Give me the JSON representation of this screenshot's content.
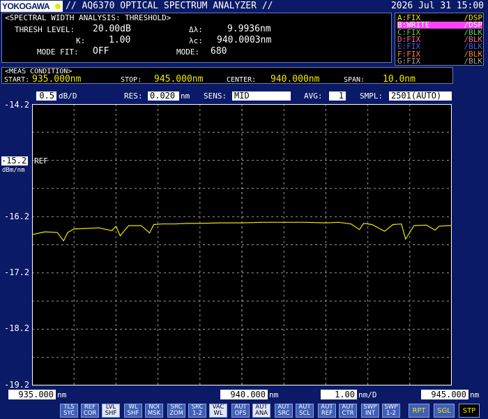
{
  "brand": "YOKOGAWA",
  "app_title": "// AQ6370 OPTICAL SPECTRUM ANALYZER //",
  "datetime": "2026 Jul 31 15:00",
  "analysis": {
    "header": "<SPECTRAL WIDTH ANALYSIS: THRESHOLD>",
    "thresh_label": "THRESH LEVEL:",
    "thresh_value": "20.00dB",
    "k_label": "K:",
    "k_value": "1.00",
    "modefit_label": "MODE FIT:",
    "modefit_value": "OFF",
    "dl_label": "Δλ:",
    "dl_value": "9.9936nm",
    "lc_label": "λc:",
    "lc_value": "940.0003nm",
    "mode_label": "MODE:",
    "mode_value": "680"
  },
  "traces": [
    {
      "left": "A:FIX",
      "right": "/DSP",
      "color": "#f2e600",
      "active": false
    },
    {
      "left": "B:WRITE",
      "right": "/DSP",
      "color": "#ff40ff",
      "active": true
    },
    {
      "left": "C:FIX",
      "right": "/BLK",
      "color": "#40e040",
      "active": false
    },
    {
      "left": "D:FIX",
      "right": "/BLK",
      "color": "#ff60a0",
      "active": false
    },
    {
      "left": "E:FIX",
      "right": "/BLK",
      "color": "#4060ff",
      "active": false
    },
    {
      "left": "F:FIX",
      "right": "/BLK",
      "color": "#ff8020",
      "active": false
    },
    {
      "left": "G:FIX",
      "right": "/BLK",
      "color": "#a0a0a0",
      "active": false
    }
  ],
  "meas": {
    "header": "<MEAS CONDITION>",
    "start_label": "START:",
    "start_value": "935.000nm",
    "stop_label": "STOP:",
    "stop_value": "945.000nm",
    "center_label": "CENTER:",
    "center_value": "940.000nm",
    "span_label": "SPAN:",
    "span_value": "10.0nm"
  },
  "setup": {
    "scale_value": "0.5",
    "scale_unit": "dB/D",
    "res_label": "RES:",
    "res_value": "0.020",
    "res_unit": "nm",
    "sens_label": "SENS:",
    "sens_value": "MID",
    "avg_label": "AVG:",
    "avg_value": "1",
    "smpl_label": "SMPL:",
    "smpl_value": "2501(AUTO)"
  },
  "yaxis": {
    "ticks": [
      "-14.2",
      "-16.2",
      "-17.2",
      "-18.2",
      "-19.2"
    ],
    "ref_value": "-15.2",
    "ref_label": "REF",
    "unit": "dBm/nm"
  },
  "xaxis": {
    "start": "935.000",
    "center": "940.000",
    "div": "1.00",
    "stop": "945.000",
    "unit": "nm",
    "div_unit": "nm/D"
  },
  "chart_data": {
    "type": "line",
    "xlim": [
      935,
      945
    ],
    "ylim": [
      -19.2,
      -14.2
    ],
    "grid": true,
    "series": [
      {
        "color": "#f2e600",
        "x": [
          935.0,
          935.3,
          935.6,
          935.75,
          935.85,
          936.0,
          936.3,
          936.6,
          936.9,
          937.0,
          937.1,
          937.3,
          937.6,
          937.8,
          937.9,
          938.1,
          938.4,
          938.7,
          939.0,
          939.5,
          940.0,
          940.5,
          941.0,
          941.5,
          942.0,
          942.3,
          942.6,
          942.8,
          942.9,
          943.1,
          943.4,
          943.6,
          943.8,
          943.9,
          944.1,
          944.4,
          944.6,
          944.7,
          944.9,
          945.0
        ],
        "y": [
          -16.52,
          -16.47,
          -16.48,
          -16.63,
          -16.48,
          -16.42,
          -16.41,
          -16.4,
          -16.45,
          -16.37,
          -16.54,
          -16.36,
          -16.36,
          -16.49,
          -16.34,
          -16.33,
          -16.33,
          -16.32,
          -16.32,
          -16.31,
          -16.31,
          -16.3,
          -16.3,
          -16.3,
          -16.31,
          -16.3,
          -16.33,
          -16.43,
          -16.32,
          -16.34,
          -16.46,
          -16.34,
          -16.33,
          -16.6,
          -16.36,
          -16.35,
          -16.44,
          -16.37,
          -16.36,
          -16.36
        ]
      }
    ]
  },
  "softkeys": [
    {
      "l1": "TLS",
      "l2": "SYC",
      "on": false
    },
    {
      "l1": "REF",
      "l2": "COR",
      "on": false
    },
    {
      "l1": "LVL",
      "l2": "SHF",
      "on": true
    },
    {
      "l1": "WL",
      "l2": "SHF",
      "on": false
    },
    {
      "l1": "NOI",
      "l2": "MSK",
      "on": false
    },
    {
      "l1": "SRC",
      "l2": "ZOM",
      "on": false
    },
    {
      "l1": "SRC",
      "l2": "1-2",
      "on": false
    },
    {
      "l1": "VAC",
      "l2": "WL",
      "on": true
    },
    {
      "l1": "AUT",
      "l2": "OFS",
      "on": false
    },
    {
      "l1": "AUT",
      "l2": "ANA",
      "on": true
    },
    {
      "l1": "AUT",
      "l2": "SRC",
      "on": false
    },
    {
      "l1": "AUT",
      "l2": "SCL",
      "on": false
    },
    {
      "l1": "AUT",
      "l2": "REF",
      "on": false
    },
    {
      "l1": "AUT",
      "l2": "CTR",
      "on": false
    },
    {
      "l1": "SWP",
      "l2": "INT",
      "on": false
    },
    {
      "l1": "SWP",
      "l2": "1-2",
      "on": false
    }
  ],
  "func_keys": {
    "rpt": "RPT",
    "sgl": "SGL",
    "stp": "STP"
  }
}
